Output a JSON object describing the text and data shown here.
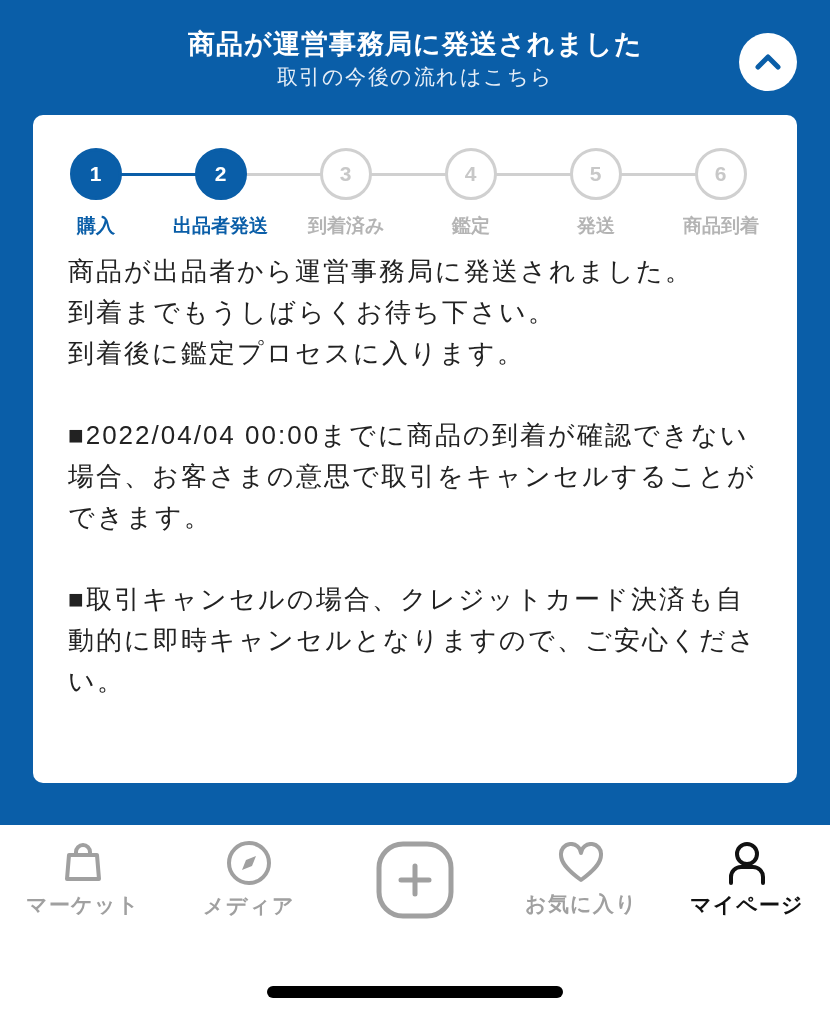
{
  "header": {
    "title": "商品が運営事務局に発送されました",
    "subtitle": "取引の今後の流れはこちら",
    "expanded": true
  },
  "steps": [
    {
      "number": "1",
      "label": "購入",
      "done": true
    },
    {
      "number": "2",
      "label": "出品者発送",
      "done": true
    },
    {
      "number": "3",
      "label": "到着済み",
      "done": false
    },
    {
      "number": "4",
      "label": "鑑定",
      "done": false
    },
    {
      "number": "5",
      "label": "発送",
      "done": false
    },
    {
      "number": "6",
      "label": "商品到着",
      "done": false
    }
  ],
  "paragraphs": [
    [
      "商品が出品者から運営事務局に発送されました。",
      "到着までもうしばらくお待ち下さい。",
      "到着後に鑑定プロセスに入ります。"
    ],
    [
      "■2022/04/04 00:00までに商品の到着が確認できない場合、お客さまの意思で取引をキャンセルすることができます。"
    ],
    [
      "■取引キャンセルの場合、クレジットカード決済も自動的に即時キャンセルとなりますので、ご安心ください。"
    ]
  ],
  "nav": [
    {
      "kind": "market",
      "label": "マーケット",
      "selected": false
    },
    {
      "kind": "media",
      "label": "メディア",
      "selected": false
    },
    {
      "kind": "add",
      "selected": false
    },
    {
      "kind": "favorites",
      "label": "お気に入り",
      "selected": false
    },
    {
      "kind": "mypage",
      "label": "マイページ",
      "selected": true
    }
  ]
}
